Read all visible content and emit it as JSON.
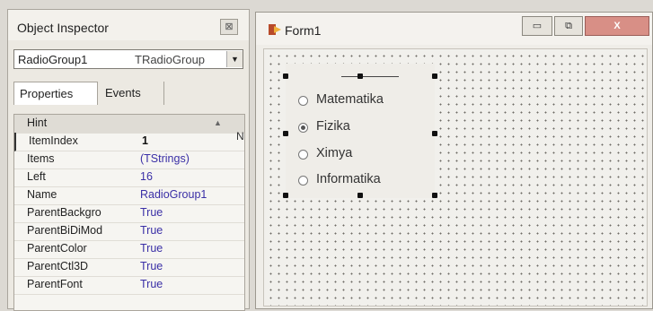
{
  "inspector": {
    "title": "Object Inspector",
    "close_glyph": "⊠",
    "component_name": "RadioGroup1",
    "component_type": "TRadioGroup",
    "tabs": [
      {
        "label": "Properties",
        "active": true
      },
      {
        "label": "Events",
        "active": false
      }
    ],
    "properties": [
      {
        "name": "Hint",
        "value": ""
      },
      {
        "name": "ItemIndex",
        "value": "1"
      },
      {
        "name": "Items",
        "value": "(TStrings)"
      },
      {
        "name": "Left",
        "value": "16"
      },
      {
        "name": "Name",
        "value": "RadioGroup1"
      },
      {
        "name": "ParentBackgro",
        "value": "True"
      },
      {
        "name": "ParentBiDiMod",
        "value": "True"
      },
      {
        "name": "ParentColor",
        "value": "True"
      },
      {
        "name": "ParentCtl3D",
        "value": "True"
      },
      {
        "name": "ParentFont",
        "value": "True"
      }
    ],
    "scroll_mark": "N"
  },
  "form": {
    "title": "Form1",
    "minimize_glyph": "▭",
    "maximize_glyph": "⧉",
    "close_glyph": "X",
    "radio_group": {
      "items": [
        "Matematika",
        "Fizika",
        "Ximya",
        "Informatika"
      ],
      "selected_index": 1
    }
  },
  "colors": {
    "value_text": "#3a2fa6",
    "close_button": "#d88f86"
  }
}
